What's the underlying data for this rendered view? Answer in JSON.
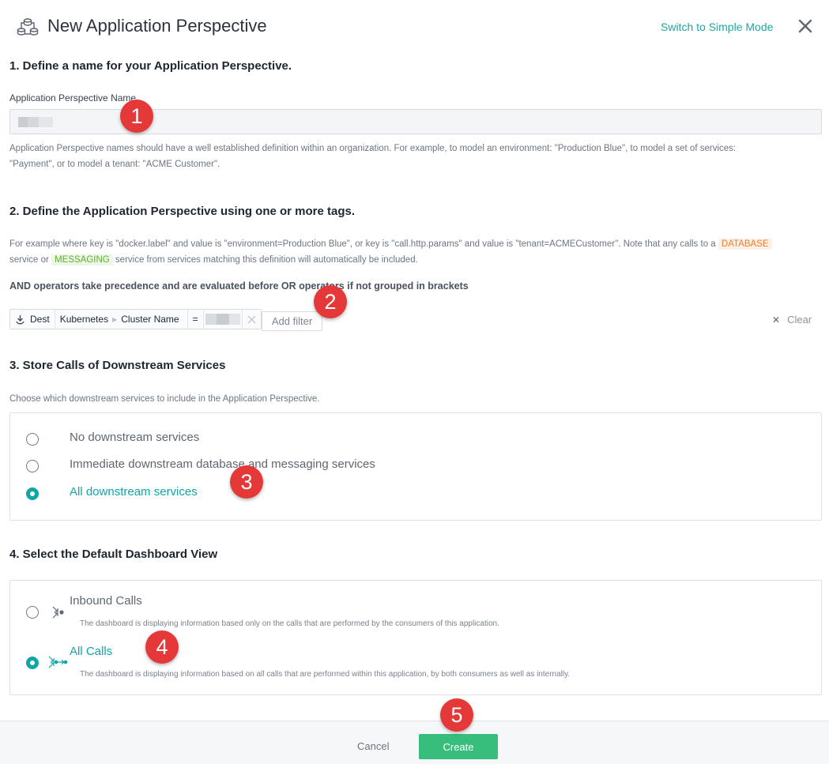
{
  "header": {
    "title": "New Application Perspective",
    "switch_mode_label": "Switch to Simple Mode",
    "icon": "application-perspective-icon",
    "close_icon": "close-icon"
  },
  "section1": {
    "title": "1. Define a name for your Application Perspective.",
    "field_label": "Application Perspective Name",
    "field_value": "",
    "help_line1": "Application Perspective names should have a well established definition within an organization. For example, to model an environment: \"Production Blue\", to model a set of services:",
    "help_line2": "\"Payment\", or to model a tenant: \"ACME Customer\"."
  },
  "section2": {
    "title": "2. Define the Application Perspective using one or more tags.",
    "help_part1": "For example where key is \"docker.label\" and value is \"environment=Production Blue\", or key is \"call.http.params\" and value is \"tenant=ACMECustomer\". Note that any calls to a",
    "tag_database": "DATABASE",
    "help_part2": "service or",
    "tag_messaging": "MESSAGING",
    "help_part3": "service from services matching this definition will automatically be included.",
    "note": "AND operators take precedence and are evaluated before OR operators if not grouped in brackets",
    "filter": {
      "direction": "Dest",
      "category": "Kubernetes",
      "key": "Cluster Name",
      "operator": "=",
      "value": ""
    },
    "add_filter_label": "Add filter",
    "clear_label": "Clear"
  },
  "section3": {
    "title": "3. Store Calls of Downstream Services",
    "help": "Choose which downstream services to include in the Application Perspective.",
    "options": [
      {
        "label": "No downstream services",
        "selected": false
      },
      {
        "label": "Immediate downstream database and messaging services",
        "selected": false
      },
      {
        "label": "All downstream services",
        "selected": true
      }
    ]
  },
  "section4": {
    "title": "4. Select the Default Dashboard View",
    "options": [
      {
        "label": "Inbound Calls",
        "description": "The dashboard is displaying information based only on the calls that are performed by the consumers of this application.",
        "selected": false
      },
      {
        "label": "All Calls",
        "description": "The dashboard is displaying information based on all calls that are performed within this application, by both consumers as well as internally.",
        "selected": true
      }
    ]
  },
  "footer": {
    "cancel_label": "Cancel",
    "create_label": "Create"
  },
  "annotations": [
    "1",
    "2",
    "3",
    "4",
    "5"
  ],
  "colors": {
    "accent": "#10a6a6",
    "create": "#38be7c",
    "badge": "#e53838",
    "database_tag": "#f07e2c",
    "messaging_tag": "#61b033"
  }
}
